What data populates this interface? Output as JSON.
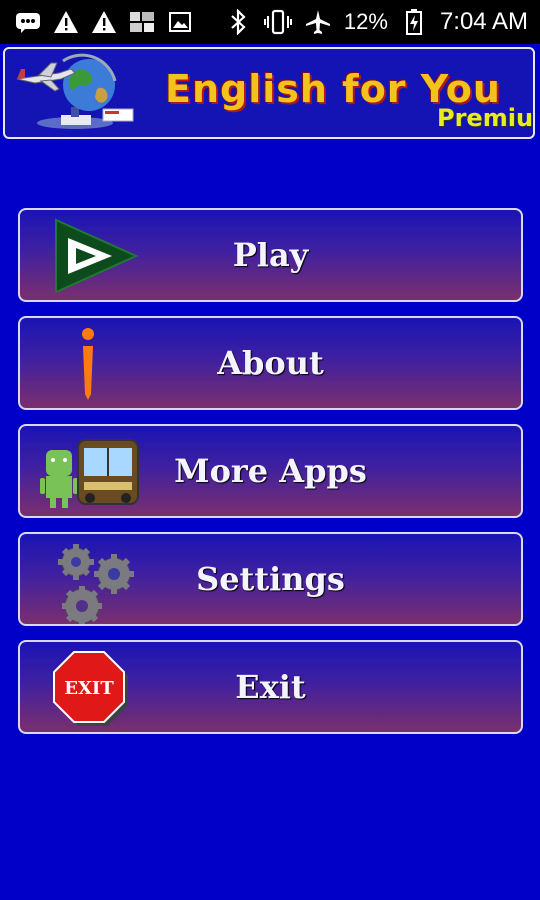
{
  "status_bar": {
    "left_icons": [
      "message-icon",
      "warning-icon",
      "warning-icon",
      "gallery-icon",
      "image-icon"
    ],
    "right_icons": [
      "bluetooth-icon",
      "vibrate-icon",
      "airplane-icon",
      "battery-icon"
    ],
    "battery": "12%",
    "time": "7:04 AM"
  },
  "header": {
    "title": "English for You",
    "edition": "Premium",
    "logo_icon": "globe-airplane-logo"
  },
  "menu": {
    "items": [
      {
        "label": "Play",
        "icon": "play-icon"
      },
      {
        "label": "About",
        "icon": "info-icon"
      },
      {
        "label": "More Apps",
        "icon": "android-bus-icon"
      },
      {
        "label": "Settings",
        "icon": "gears-icon"
      },
      {
        "label": "Exit",
        "icon": "exit-sign-icon",
        "icon_text": "EXIT"
      }
    ]
  },
  "colors": {
    "background": "#0000c8",
    "button_top": "#1a14b4",
    "button_bottom": "#7a2f6e",
    "title_yellow": "#f2c21e",
    "premium_green": "#e6ec1e"
  }
}
